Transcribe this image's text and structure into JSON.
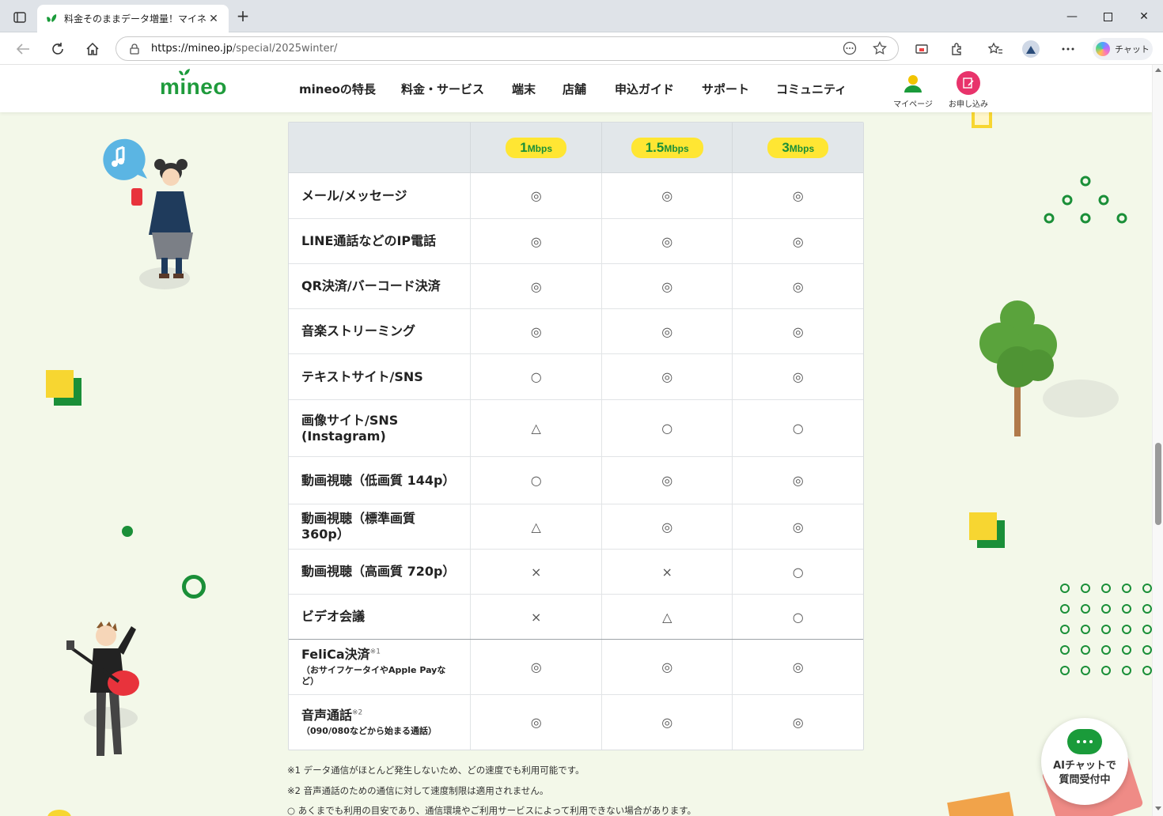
{
  "browser": {
    "tab_title": "料金そのままデータ増量！マイネオが",
    "url_host": "https://mineo.jp",
    "url_path": "/special/2025winter/",
    "chat_label": "チャット"
  },
  "site": {
    "logo": "mineo",
    "nav": [
      "mineoの特長",
      "料金・サービス",
      "端末",
      "店舗",
      "申込ガイド",
      "サポート",
      "コミュニティ"
    ],
    "mypage": "マイページ",
    "apply": "お申し込み"
  },
  "table": {
    "speeds": [
      {
        "num": "1",
        "unit": "Mbps"
      },
      {
        "num": "1.5",
        "unit": "Mbps"
      },
      {
        "num": "3",
        "unit": "Mbps"
      }
    ],
    "rows": [
      {
        "label": "メール/メッセージ",
        "values": [
          "◎",
          "◎",
          "◎"
        ]
      },
      {
        "label": "LINE通話などのIP電話",
        "values": [
          "◎",
          "◎",
          "◎"
        ]
      },
      {
        "label": "QR決済/バーコード決済",
        "values": [
          "◎",
          "◎",
          "◎"
        ]
      },
      {
        "label": "音楽ストリーミング",
        "values": [
          "◎",
          "◎",
          "◎"
        ]
      },
      {
        "label": "テキストサイト/SNS",
        "values": [
          "○",
          "◎",
          "◎"
        ]
      },
      {
        "label": "画像サイト/SNS (Instagram)",
        "values": [
          "△",
          "○",
          "○"
        ]
      },
      {
        "label": "動画視聴（低画質 144p）",
        "values": [
          "○",
          "◎",
          "◎"
        ]
      },
      {
        "label": "動画視聴（標準画質 360p）",
        "values": [
          "△",
          "◎",
          "◎"
        ]
      },
      {
        "label": "動画視聴（高画質 720p）",
        "values": [
          "×",
          "×",
          "○"
        ]
      },
      {
        "label": "ビデオ会議",
        "values": [
          "×",
          "△",
          "○"
        ]
      },
      {
        "label": "FeliCa決済",
        "sup": "※1",
        "sub": "（おサイフケータイやApple Payなど）",
        "values": [
          "◎",
          "◎",
          "◎"
        ]
      },
      {
        "label": "音声通話",
        "sup": "※2",
        "sub": "（090/080などから始まる通話）",
        "values": [
          "◎",
          "◎",
          "◎"
        ]
      }
    ]
  },
  "notes": [
    "※1 データ通信がほとんど発生しないため、どの速度でも利用可能です。",
    "※2 音声通話のための通信に対して速度制限は適用されません。",
    "○ あくまでも利用の目安であり、通信環境やご利用サービスによって利用できない場合があります。"
  ],
  "ai_chat": {
    "line1": "AIチャットで",
    "line2": "質問受付中"
  }
}
